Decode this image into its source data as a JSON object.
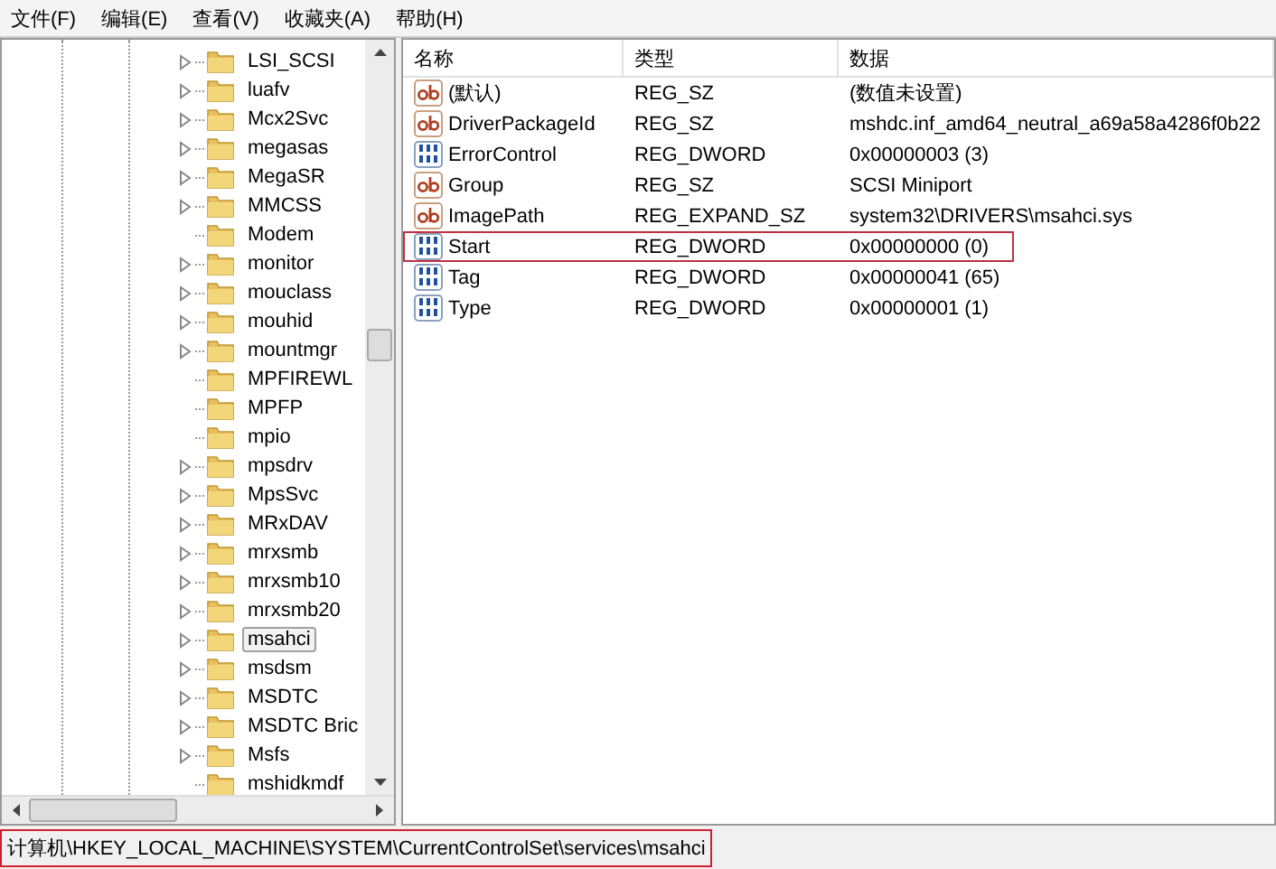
{
  "menu": [
    {
      "label": "文件(F)"
    },
    {
      "label": "编辑(E)"
    },
    {
      "label": "查看(V)"
    },
    {
      "label": "收藏夹(A)"
    },
    {
      "label": "帮助(H)"
    }
  ],
  "tree": {
    "items": [
      {
        "label": "LSI_SCSI",
        "expandable": true,
        "selected": false
      },
      {
        "label": "luafv",
        "expandable": true,
        "selected": false
      },
      {
        "label": "Mcx2Svc",
        "expandable": true,
        "selected": false
      },
      {
        "label": "megasas",
        "expandable": true,
        "selected": false
      },
      {
        "label": "MegaSR",
        "expandable": true,
        "selected": false
      },
      {
        "label": "MMCSS",
        "expandable": true,
        "selected": false
      },
      {
        "label": "Modem",
        "expandable": false,
        "selected": false
      },
      {
        "label": "monitor",
        "expandable": true,
        "selected": false
      },
      {
        "label": "mouclass",
        "expandable": true,
        "selected": false
      },
      {
        "label": "mouhid",
        "expandable": true,
        "selected": false
      },
      {
        "label": "mountmgr",
        "expandable": true,
        "selected": false
      },
      {
        "label": "MPFIREWL",
        "expandable": false,
        "selected": false
      },
      {
        "label": "MPFP",
        "expandable": false,
        "selected": false
      },
      {
        "label": "mpio",
        "expandable": false,
        "selected": false
      },
      {
        "label": "mpsdrv",
        "expandable": true,
        "selected": false
      },
      {
        "label": "MpsSvc",
        "expandable": true,
        "selected": false
      },
      {
        "label": "MRxDAV",
        "expandable": true,
        "selected": false
      },
      {
        "label": "mrxsmb",
        "expandable": true,
        "selected": false
      },
      {
        "label": "mrxsmb10",
        "expandable": true,
        "selected": false
      },
      {
        "label": "mrxsmb20",
        "expandable": true,
        "selected": false
      },
      {
        "label": "msahci",
        "expandable": true,
        "selected": true
      },
      {
        "label": "msdsm",
        "expandable": true,
        "selected": false
      },
      {
        "label": "MSDTC",
        "expandable": true,
        "selected": false
      },
      {
        "label": "MSDTC Bric",
        "expandable": true,
        "selected": false
      },
      {
        "label": "Msfs",
        "expandable": true,
        "selected": false
      },
      {
        "label": "mshidkmdf",
        "expandable": false,
        "selected": false
      }
    ]
  },
  "values": {
    "columns": [
      "名称",
      "类型",
      "数据"
    ],
    "rows": [
      {
        "kind": "string",
        "name": "(默认)",
        "type": "REG_SZ",
        "data": "(数值未设置)",
        "highlighted": false
      },
      {
        "kind": "string",
        "name": "DriverPackageId",
        "type": "REG_SZ",
        "data": "mshdc.inf_amd64_neutral_a69a58a4286f0b22",
        "highlighted": false
      },
      {
        "kind": "binary",
        "name": "ErrorControl",
        "type": "REG_DWORD",
        "data": "0x00000003 (3)",
        "highlighted": false
      },
      {
        "kind": "string",
        "name": "Group",
        "type": "REG_SZ",
        "data": "SCSI Miniport",
        "highlighted": false
      },
      {
        "kind": "string",
        "name": "ImagePath",
        "type": "REG_EXPAND_SZ",
        "data": "system32\\DRIVERS\\msahci.sys",
        "highlighted": false
      },
      {
        "kind": "binary",
        "name": "Start",
        "type": "REG_DWORD",
        "data": "0x00000000 (0)",
        "highlighted": true
      },
      {
        "kind": "binary",
        "name": "Tag",
        "type": "REG_DWORD",
        "data": "0x00000041 (65)",
        "highlighted": false
      },
      {
        "kind": "binary",
        "name": "Type",
        "type": "REG_DWORD",
        "data": "0x00000001 (1)",
        "highlighted": false
      }
    ]
  },
  "status_bar": {
    "text": "计算机\\HKEY_LOCAL_MACHINE\\SYSTEM\\CurrentControlSet\\services\\msahci",
    "highlighted": true
  }
}
